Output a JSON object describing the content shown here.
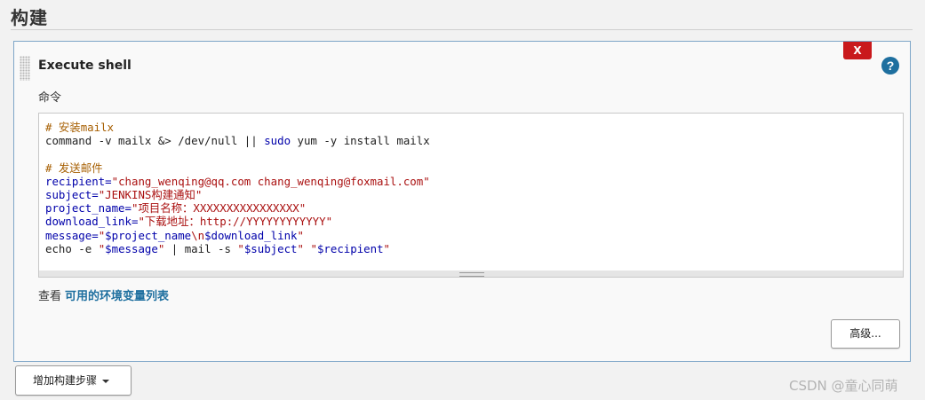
{
  "section": {
    "title": "构建"
  },
  "step": {
    "title": "Execute shell",
    "delete_label": "X",
    "help_label": "?",
    "command_label": "命令",
    "script_lines": [
      [
        {
          "t": "# 安装mailx",
          "c": "cm"
        }
      ],
      [
        {
          "t": "command -v mailx &> /dev/null || ",
          "c": ""
        },
        {
          "t": "sudo",
          "c": "vr"
        },
        {
          "t": " yum -y install mailx",
          "c": ""
        }
      ],
      [
        {
          "t": "",
          "c": ""
        }
      ],
      [
        {
          "t": "# 发送邮件",
          "c": "cm"
        }
      ],
      [
        {
          "t": "recipient=",
          "c": "vr"
        },
        {
          "t": "\"chang_wenqing@qq.com chang_wenqing@foxmail.com\"",
          "c": "st"
        }
      ],
      [
        {
          "t": "subject=",
          "c": "vr"
        },
        {
          "t": "\"JENKINS构建通知\"",
          "c": "st"
        }
      ],
      [
        {
          "t": "project_name=",
          "c": "vr"
        },
        {
          "t": "\"项目名称：XXXXXXXXXXXXXXXX\"",
          "c": "st"
        }
      ],
      [
        {
          "t": "download_link=",
          "c": "vr"
        },
        {
          "t": "\"下载地址：http://YYYYYYYYYYYY\"",
          "c": "st"
        }
      ],
      [
        {
          "t": "message=",
          "c": "vr"
        },
        {
          "t": "\"",
          "c": "st"
        },
        {
          "t": "$project_name",
          "c": "vr"
        },
        {
          "t": "\\n",
          "c": "st"
        },
        {
          "t": "$download_link",
          "c": "vr"
        },
        {
          "t": "\"",
          "c": "st"
        }
      ],
      [
        {
          "t": "echo -e ",
          "c": ""
        },
        {
          "t": "\"",
          "c": "st"
        },
        {
          "t": "$message",
          "c": "vr"
        },
        {
          "t": "\"",
          "c": "st"
        },
        {
          "t": " | mail -s ",
          "c": ""
        },
        {
          "t": "\"",
          "c": "st"
        },
        {
          "t": "$subject",
          "c": "vr"
        },
        {
          "t": "\"",
          "c": "st"
        },
        {
          "t": " ",
          "c": ""
        },
        {
          "t": "\"",
          "c": "st"
        },
        {
          "t": "$recipient",
          "c": "vr"
        },
        {
          "t": "\"",
          "c": "st"
        }
      ]
    ],
    "env_prefix": "查看",
    "env_link": "可用的环境变量列表",
    "advanced_label": "高级..."
  },
  "add_step_label": "增加构建步骤",
  "watermark": "CSDN @童心同萌",
  "colors": {
    "accent": "#1e6f9f",
    "delete": "#c9191c",
    "comment": "#a65e00",
    "string": "#aa1111",
    "variable": "#0000aa"
  }
}
